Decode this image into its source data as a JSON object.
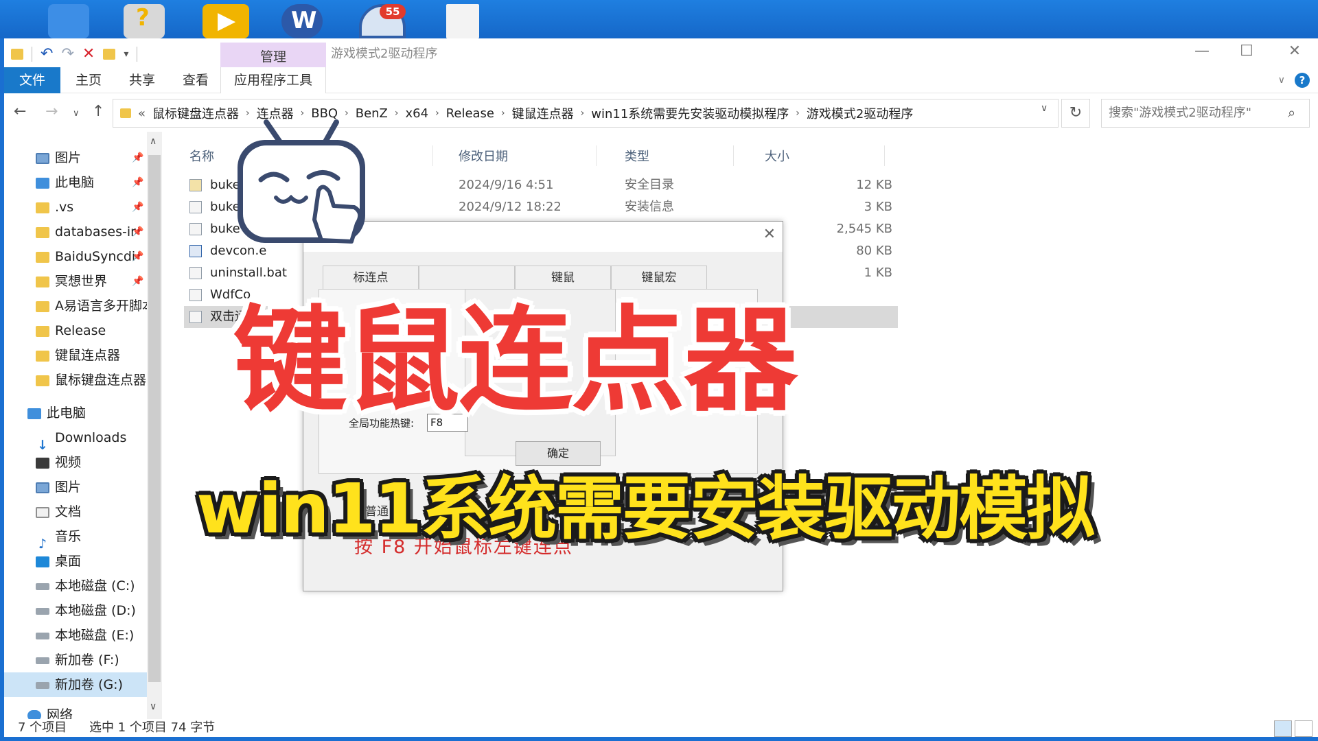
{
  "desktop": {
    "badge_count": "55"
  },
  "window": {
    "title": "游戏模式2驱动程序",
    "manage_tab": "管理",
    "app_tools_tab": "应用程序工具",
    "controls": {
      "minimize": "—",
      "maximize": "☐",
      "close": "✕"
    }
  },
  "ribbon": {
    "tabs": [
      "文件",
      "主页",
      "共享",
      "查看"
    ]
  },
  "address": {
    "lead": "«",
    "crumbs": [
      "鼠标键盘连点器",
      "连点器",
      "BBQ",
      "BenZ",
      "x64",
      "Release",
      "键鼠连点器",
      "win11系统需要先安装驱动模拟程序",
      "游戏模式2驱动程序"
    ],
    "search_placeholder": "搜索\"游戏模式2驱动程序\""
  },
  "sidebar": {
    "quick_access": [
      {
        "label": "图片",
        "icon": "picture-icon",
        "pinned": true
      },
      {
        "label": "此电脑",
        "icon": "computer-icon",
        "pinned": true
      },
      {
        "label": ".vs",
        "icon": "folder-icon",
        "pinned": true
      },
      {
        "label": "databases-ir",
        "icon": "folder-icon",
        "pinned": true
      },
      {
        "label": "BaiduSyncdi",
        "icon": "folder-icon",
        "pinned": true
      },
      {
        "label": "冥想世界",
        "icon": "folder-icon",
        "pinned": true
      },
      {
        "label": "A易语言多开脚本",
        "icon": "folder-icon",
        "pinned": false
      },
      {
        "label": "Release",
        "icon": "folder-icon",
        "pinned": false
      },
      {
        "label": "键鼠连点器",
        "icon": "folder-icon",
        "pinned": false
      },
      {
        "label": "鼠标键盘连点器",
        "icon": "folder-icon",
        "pinned": false
      }
    ],
    "this_pc": "此电脑",
    "pc_items": [
      {
        "label": "Downloads",
        "icon": "download-icon"
      },
      {
        "label": "视频",
        "icon": "video-icon"
      },
      {
        "label": "图片",
        "icon": "picture-icon"
      },
      {
        "label": "文档",
        "icon": "document-icon"
      },
      {
        "label": "音乐",
        "icon": "music-icon"
      },
      {
        "label": "桌面",
        "icon": "desktop-icon"
      },
      {
        "label": "本地磁盘 (C:)",
        "icon": "drive-icon"
      },
      {
        "label": "本地磁盘 (D:)",
        "icon": "drive-icon"
      },
      {
        "label": "本地磁盘 (E:)",
        "icon": "drive-icon"
      },
      {
        "label": "新加卷 (F:)",
        "icon": "drive-icon"
      },
      {
        "label": "新加卷 (G:)",
        "icon": "drive-icon"
      }
    ],
    "network": "网络"
  },
  "columns": {
    "name": "名称",
    "date": "修改日期",
    "type": "类型",
    "size": "大小"
  },
  "files": [
    {
      "name": "buke",
      "date": "2024/9/16 4:51",
      "type": "安全目录",
      "size": "12 KB"
    },
    {
      "name": "buke",
      "date": "2024/9/12 18:22",
      "type": "安装信息",
      "size": "3 KB"
    },
    {
      "name": "buke",
      "date": "",
      "type": "",
      "size": "2,545 KB"
    },
    {
      "name": "devcon.e",
      "date": "",
      "type": "",
      "size": "80 KB"
    },
    {
      "name": "uninstall.bat",
      "date": "",
      "type": "",
      "size": "1 KB"
    },
    {
      "name": "WdfCo",
      "date": "",
      "type": "",
      "size": ""
    },
    {
      "name": "双击运",
      "date": "",
      "type": "",
      "size": ""
    }
  ],
  "status": {
    "count": "7 个项目",
    "selection": "选中 1 个项目  74 字节"
  },
  "dialog": {
    "close": "✕",
    "tabs": [
      "标连点",
      "",
      "键鼠",
      "键鼠宏"
    ],
    "inner_text": "nZ",
    "hotkey_label": "全局功能热键:",
    "hotkey_value": "F8",
    "ok_label": "确定",
    "ordinary_label": "普通",
    "hint": "按  F8  开始鼠标左键连点"
  },
  "overlay": {
    "title": "键鼠连点器",
    "subtitle": "win11系统需要安装驱动模拟"
  }
}
